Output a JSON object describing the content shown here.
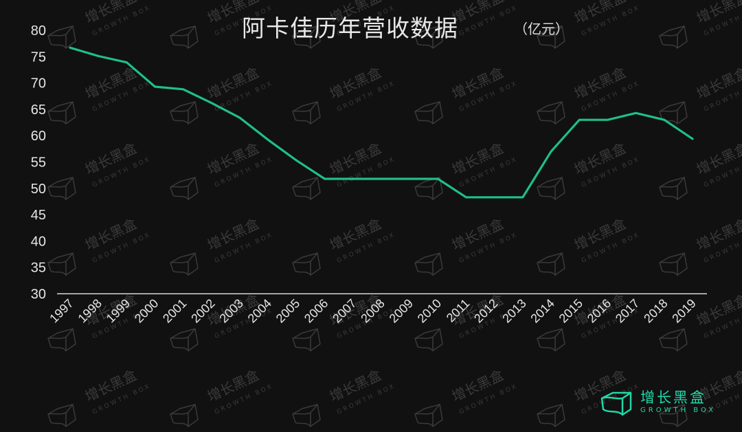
{
  "chart_data": {
    "type": "line",
    "title": "阿卡佳历年营收数据",
    "unit_label": "（亿元）",
    "xlabel": "",
    "ylabel": "",
    "ylim": [
      30,
      80
    ],
    "yticks": [
      30,
      35,
      40,
      45,
      50,
      55,
      60,
      65,
      70,
      75,
      80
    ],
    "grid": false,
    "legend": "none",
    "categories": [
      "1997",
      "1998",
      "1999",
      "2000",
      "2001",
      "2002",
      "2003",
      "2004",
      "2005",
      "2006",
      "2007",
      "2008",
      "2009",
      "2010",
      "2011",
      "2012",
      "2013",
      "2014",
      "2015",
      "2016",
      "2017",
      "2018",
      "2019"
    ],
    "series": [
      {
        "name": "营收",
        "color": "#1fbf8a",
        "values": [
          76.7,
          75.1,
          73.9,
          69.3,
          68.8,
          66.2,
          63.4,
          59.2,
          55.3,
          51.8,
          51.8,
          51.8,
          51.8,
          51.8,
          48.3,
          48.3,
          48.3,
          57.0,
          63.0,
          63.0,
          64.3,
          63.0,
          59.4
        ]
      }
    ]
  },
  "watermark": {
    "cn": "增长黑盒",
    "en": "GROWTH BOX"
  },
  "logo": {
    "cn": "增长黑盒",
    "en": "GROWTH BOX",
    "color": "#1ed8a8"
  }
}
